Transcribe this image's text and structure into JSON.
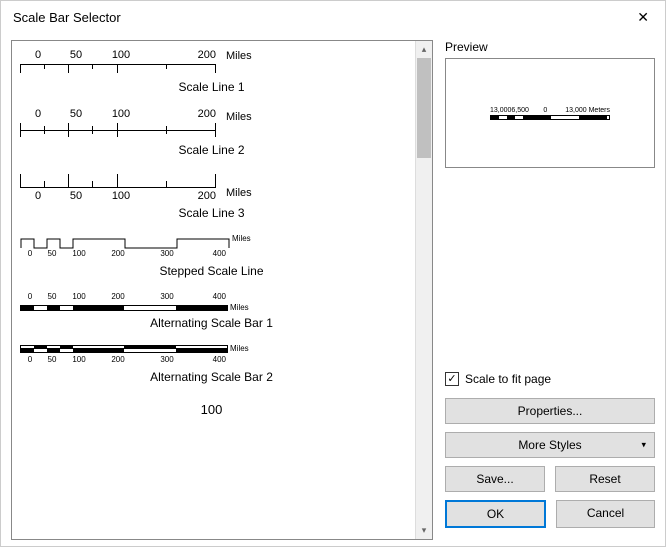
{
  "title": "Scale Bar Selector",
  "preview_label": "Preview",
  "preview_nums": [
    "13,0006,500",
    "0",
    "13,000 Meters"
  ],
  "checkbox_label": "Scale to fit page",
  "checkbox_checked": true,
  "buttons": {
    "properties": "Properties...",
    "more_styles": "More Styles",
    "save": "Save...",
    "reset": "Reset",
    "ok": "OK",
    "cancel": "Cancel"
  },
  "items": [
    {
      "name": "Scale Line 1",
      "ticks": [
        "0",
        "50",
        "100",
        "200"
      ],
      "unit": "Miles"
    },
    {
      "name": "Scale Line 2",
      "ticks": [
        "0",
        "50",
        "100",
        "200"
      ],
      "unit": "Miles"
    },
    {
      "name": "Scale Line 3",
      "ticks": [
        "0",
        "50",
        "100",
        "200"
      ],
      "unit": "Miles"
    },
    {
      "name": "Stepped Scale Line",
      "smallticks": [
        "0",
        "50",
        "100",
        "200",
        "300",
        "400"
      ],
      "unit": "Miles"
    },
    {
      "name": "Alternating Scale Bar 1",
      "smallticks": [
        "0",
        "50",
        "100",
        "200",
        "300",
        "400"
      ],
      "unit": "Miles"
    },
    {
      "name": "Alternating Scale Bar 2",
      "smallticks": [
        "0",
        "50",
        "100",
        "200",
        "300",
        "400"
      ],
      "unit": "Miles"
    },
    {
      "partial": "100"
    }
  ]
}
